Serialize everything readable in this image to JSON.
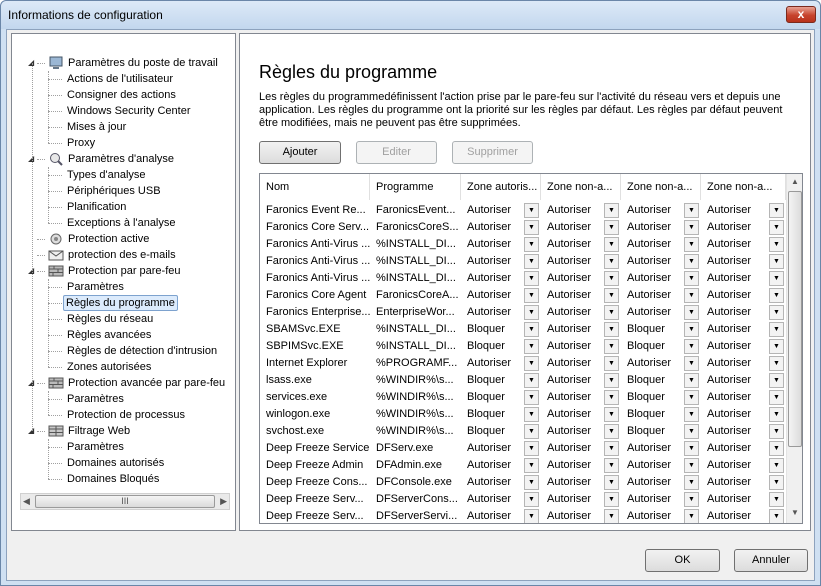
{
  "window": {
    "title": "Informations de configuration",
    "close_glyph": "x"
  },
  "tree": {
    "items": [
      {
        "label": "Paramètres du poste de travail",
        "level": 0,
        "expanded": true,
        "icon": "workstation-icon"
      },
      {
        "label": "Actions de l'utilisateur",
        "level": 1
      },
      {
        "label": "Consigner des actions",
        "level": 1
      },
      {
        "label": "Windows Security Center",
        "level": 1
      },
      {
        "label": "Mises à jour",
        "level": 1
      },
      {
        "label": "Proxy",
        "level": 1
      },
      {
        "label": "Paramètres d'analyse",
        "level": 0,
        "expanded": true,
        "icon": "scan-icon"
      },
      {
        "label": "Types d'analyse",
        "level": 1
      },
      {
        "label": "Périphériques USB",
        "level": 1
      },
      {
        "label": "Planification",
        "level": 1
      },
      {
        "label": "Exceptions à l'analyse",
        "level": 1
      },
      {
        "label": "Protection active",
        "level": 0,
        "icon": "active-protection-icon"
      },
      {
        "label": "protection des e-mails",
        "level": 0,
        "icon": "email-icon"
      },
      {
        "label": "Protection par pare-feu",
        "level": 0,
        "expanded": true,
        "icon": "firewall-icon"
      },
      {
        "label": "Paramètres",
        "level": 1
      },
      {
        "label": "Règles du programme",
        "level": 1,
        "selected": true
      },
      {
        "label": "Règles du réseau",
        "level": 1
      },
      {
        "label": "Règles avancées",
        "level": 1
      },
      {
        "label": "Règles de détection d'intrusion",
        "level": 1
      },
      {
        "label": "Zones autorisées",
        "level": 1
      },
      {
        "label": "Protection avancée par pare-feu",
        "level": 0,
        "expanded": true,
        "icon": "firewall-icon"
      },
      {
        "label": "Paramètres",
        "level": 1
      },
      {
        "label": "Protection de processus",
        "level": 1
      },
      {
        "label": "Filtrage Web",
        "level": 0,
        "expanded": true,
        "icon": "web-filter-icon"
      },
      {
        "label": "Paramètres",
        "level": 1
      },
      {
        "label": "Domaines autorisés",
        "level": 1
      },
      {
        "label": "Domaines Bloqués",
        "level": 1
      }
    ],
    "hscroll_grip": "III"
  },
  "panel": {
    "title": "Règles du programme",
    "description": "Les règles du programmedéfinissent l'action prise par le pare-feu sur l'activité du réseau vers et depuis une application. Les règles du programme ont la priorité sur les règles par défaut. Les règles par défaut peuvent être modifiées, mais ne peuvent pas être supprimées.",
    "buttons": {
      "add": "Ajouter",
      "edit": "Editer",
      "delete": "Supprimer"
    }
  },
  "table": {
    "columns": [
      "Nom",
      "Programme",
      "Zone autoris...",
      "Zone non-a...",
      "Zone non-a...",
      "Zone non-a..."
    ],
    "rows": [
      [
        "Faronics Event Re...",
        "FaronicsEvent...",
        "Autoriser",
        "Autoriser",
        "Autoriser",
        "Autoriser"
      ],
      [
        "Faronics Core Serv...",
        "FaronicsCoreS...",
        "Autoriser",
        "Autoriser",
        "Autoriser",
        "Autoriser"
      ],
      [
        "Faronics Anti-Virus ...",
        "%INSTALL_DI...",
        "Autoriser",
        "Autoriser",
        "Autoriser",
        "Autoriser"
      ],
      [
        "Faronics Anti-Virus ...",
        "%INSTALL_DI...",
        "Autoriser",
        "Autoriser",
        "Autoriser",
        "Autoriser"
      ],
      [
        "Faronics Anti-Virus ...",
        "%INSTALL_DI...",
        "Autoriser",
        "Autoriser",
        "Autoriser",
        "Autoriser"
      ],
      [
        "Faronics Core Agent",
        "FaronicsCoreA...",
        "Autoriser",
        "Autoriser",
        "Autoriser",
        "Autoriser"
      ],
      [
        "Faronics Enterprise...",
        "EnterpriseWor...",
        "Autoriser",
        "Autoriser",
        "Autoriser",
        "Autoriser"
      ],
      [
        "SBAMSvc.EXE",
        "%INSTALL_DI...",
        "Bloquer",
        "Autoriser",
        "Bloquer",
        "Autoriser"
      ],
      [
        "SBPIMSvc.EXE",
        "%INSTALL_DI...",
        "Bloquer",
        "Autoriser",
        "Bloquer",
        "Autoriser"
      ],
      [
        "Internet Explorer",
        "%PROGRAMF...",
        "Autoriser",
        "Autoriser",
        "Autoriser",
        "Autoriser"
      ],
      [
        "lsass.exe",
        "%WINDIR%\\s...",
        "Bloquer",
        "Autoriser",
        "Bloquer",
        "Autoriser"
      ],
      [
        "services.exe",
        "%WINDIR%\\s...",
        "Bloquer",
        "Autoriser",
        "Bloquer",
        "Autoriser"
      ],
      [
        "winlogon.exe",
        "%WINDIR%\\s...",
        "Bloquer",
        "Autoriser",
        "Bloquer",
        "Autoriser"
      ],
      [
        "svchost.exe",
        "%WINDIR%\\s...",
        "Bloquer",
        "Autoriser",
        "Bloquer",
        "Autoriser"
      ],
      [
        "Deep Freeze Service",
        "DFServ.exe",
        "Autoriser",
        "Autoriser",
        "Autoriser",
        "Autoriser"
      ],
      [
        "Deep Freeze Admin",
        "DFAdmin.exe",
        "Autoriser",
        "Autoriser",
        "Autoriser",
        "Autoriser"
      ],
      [
        "Deep Freeze Cons...",
        "DFConsole.exe",
        "Autoriser",
        "Autoriser",
        "Autoriser",
        "Autoriser"
      ],
      [
        "Deep Freeze Serv...",
        "DFServerCons...",
        "Autoriser",
        "Autoriser",
        "Autoriser",
        "Autoriser"
      ],
      [
        "Deep Freeze Serv...",
        "DFServerServi...",
        "Autoriser",
        "Autoriser",
        "Autoriser",
        "Autoriser"
      ]
    ]
  },
  "footer": {
    "ok": "OK",
    "cancel": "Annuler"
  }
}
